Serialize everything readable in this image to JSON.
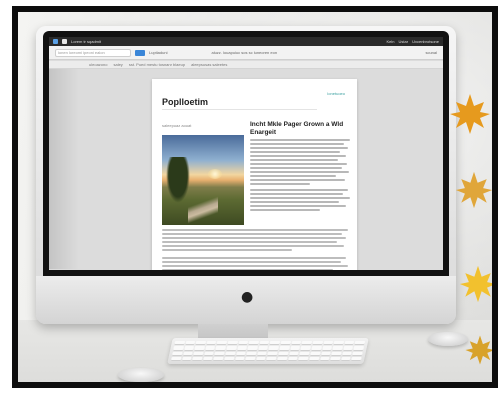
{
  "screen": {
    "menubar": {
      "left_label": "Lorem tr sqadmit",
      "right_items": [
        "Keln",
        "Ustar",
        "Uxcenbrotsone"
      ]
    },
    "toolbar": {
      "address_placeholder": "lonen loreomi ipeoni ealon",
      "tab_labels": [
        "Luptiaduni",
        "aluzz. louapuiuc sos sc luneoren  eon"
      ],
      "right_label": "scunal"
    },
    "bookmarks": [
      "uleoazono",
      "saley",
      "sst. Pued mestu tosnanr blaeup",
      "aleepsusas saleetes"
    ],
    "document": {
      "title": "Poplloetim",
      "corner_label": "lonetuoeo",
      "image_caption": "saleepuaz aouat",
      "headline": "Incht Mkle Pager Grown a Wld Enargeit"
    }
  },
  "colors": {
    "accent": "#3a86d8",
    "teal": "#3aa0a0",
    "leaf_orange": "#e69a1e",
    "leaf_yellow": "#f2c12e"
  },
  "icons": [
    "apple-logo-icon",
    "maple-leaf-icon"
  ]
}
